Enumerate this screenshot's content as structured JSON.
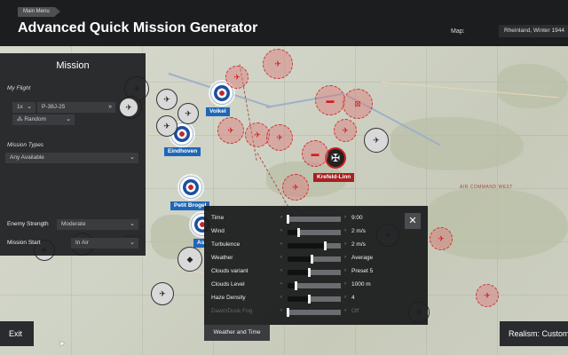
{
  "header": {
    "breadcrumb": "Main Menu",
    "title": "Advanced Quick Mission Generator",
    "map_label": "Map:",
    "map_value": "Rheinland, Winter 1944"
  },
  "mission_panel": {
    "title": "Mission",
    "my_flight_label": "My Flight",
    "flight_count": "1x",
    "aircraft": "P-38J-25",
    "loadout": "Random",
    "mission_types_label": "Mission Types",
    "mission_types_value": "Any Available",
    "enemy_strength_label": "Enemy Strength",
    "enemy_strength_value": "Moderate",
    "mission_start_label": "Mission Start",
    "mission_start_value": "In Air"
  },
  "weather_panel": {
    "tab_label": "Weather and Time",
    "close": "✕",
    "rows": [
      {
        "label": "Time",
        "value": "9:00",
        "level": 0.0
      },
      {
        "label": "Wind",
        "value": "2 m/s",
        "level": 0.2
      },
      {
        "label": "Turbulence",
        "value": "2 m/s",
        "level": 0.7
      },
      {
        "label": "Weather",
        "value": "Average",
        "level": 0.45
      },
      {
        "label": "Clouds variant",
        "value": "Preset 5",
        "level": 0.4
      },
      {
        "label": "Clouds Level",
        "value": "1000 m",
        "level": 0.15
      },
      {
        "label": "Haze Density",
        "value": "4",
        "level": 0.4
      },
      {
        "label": "Dawn/Dusk Fog",
        "value": "Off",
        "level": 0.0
      }
    ]
  },
  "map": {
    "cities": [
      {
        "name": "Volkel"
      },
      {
        "name": "Eindhoven"
      },
      {
        "name": "Petit Brogel"
      },
      {
        "name": "Asch"
      },
      {
        "name": "Krefeld-Linn"
      }
    ]
  },
  "buttons": {
    "exit": "Exit",
    "realism": "Realism: Custom"
  },
  "colors": {
    "allied": "#1e67b8",
    "axis": "#a82020",
    "panel": "#1c1d1f"
  }
}
